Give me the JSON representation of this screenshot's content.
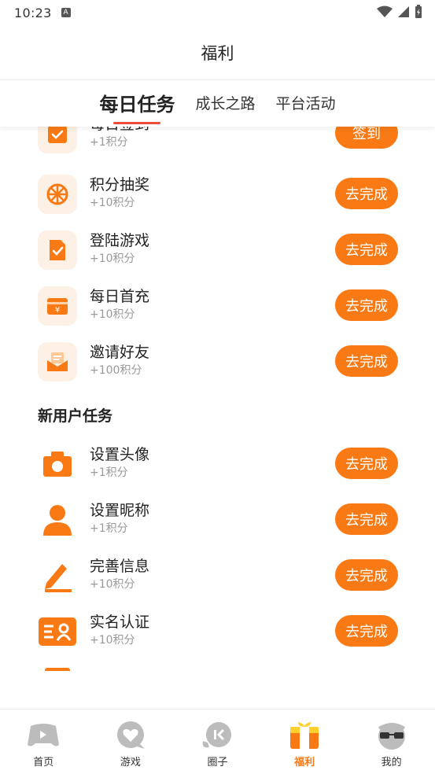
{
  "status_bar": {
    "time": "10:23",
    "notif_glyph": "A"
  },
  "header": {
    "title": "福利"
  },
  "tabs": [
    {
      "label": "每日任务",
      "active": true
    },
    {
      "label": "成长之路",
      "active": false
    },
    {
      "label": "平台活动",
      "active": false
    }
  ],
  "daily_tasks": [
    {
      "name": "每日签到",
      "points": "+1积分",
      "button": "签到",
      "icon": "calendar-check-icon"
    },
    {
      "name": "积分抽奖",
      "points": "+10积分",
      "button": "去完成",
      "icon": "lottery-wheel-icon"
    },
    {
      "name": "登陆游戏",
      "points": "+10积分",
      "button": "去完成",
      "icon": "document-check-icon"
    },
    {
      "name": "每日首充",
      "points": "+10积分",
      "button": "去完成",
      "icon": "wallet-yuan-icon"
    },
    {
      "name": "邀请好友",
      "points": "+100积分",
      "button": "去完成",
      "icon": "envelope-icon"
    }
  ],
  "new_user_section": {
    "title": "新用户任务"
  },
  "new_user_tasks": [
    {
      "name": "设置头像",
      "points": "+1积分",
      "button": "去完成",
      "icon": "camera-icon"
    },
    {
      "name": "设置昵称",
      "points": "+1积分",
      "button": "去完成",
      "icon": "person-icon"
    },
    {
      "name": "完善信息",
      "points": "+10积分",
      "button": "去完成",
      "icon": "pencil-icon"
    },
    {
      "name": "实名认证",
      "points": "+10积分",
      "button": "去完成",
      "icon": "id-card-icon"
    }
  ],
  "bottom_nav": [
    {
      "label": "首页",
      "icon": "gamepad-icon",
      "active": false
    },
    {
      "label": "游戏",
      "icon": "heart-bubble-icon",
      "active": false
    },
    {
      "label": "圈子",
      "icon": "chat-bubble-icon",
      "active": false
    },
    {
      "label": "福利",
      "icon": "gift-icon",
      "active": true
    },
    {
      "label": "我的",
      "icon": "sunglasses-face-icon",
      "active": false
    }
  ],
  "colors": {
    "accent": "#f97a14",
    "tab_underline": "#ee4b3a",
    "icon_bg": "#fdf0e5",
    "nav_gray": "#bcbcbc"
  }
}
